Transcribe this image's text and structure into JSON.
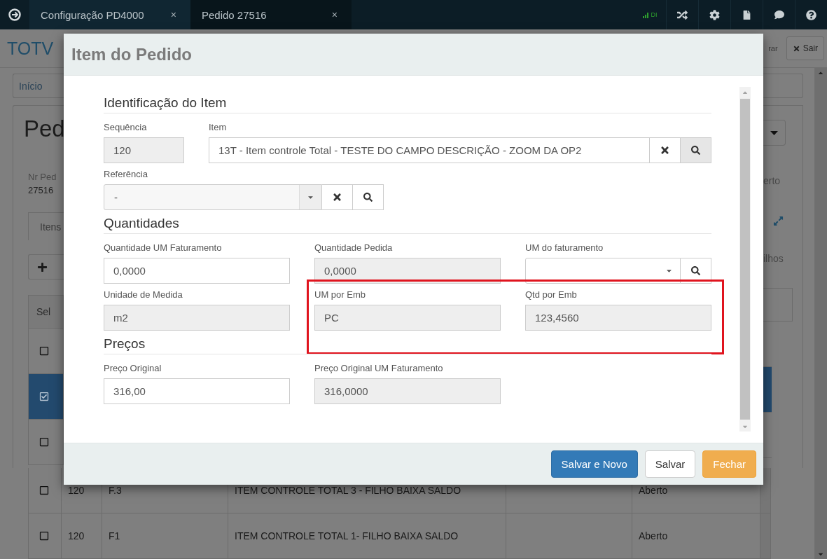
{
  "top_bar": {
    "tabs": [
      {
        "label": "Configuração PD4000",
        "close": "×",
        "selected": false
      },
      {
        "label": "Pedido 27516",
        "close": "×",
        "selected": true
      }
    ],
    "signal_label": "DI"
  },
  "background": {
    "brand": "TOTV",
    "header_fragment": "rar",
    "exit_button": "Sair",
    "breadcrumb": "Início",
    "title": "Ped",
    "order_label": "Nr Ped",
    "order_number": "27516",
    "tab": "Itens",
    "status_fragment": "erto",
    "children_fragment": "ilhos",
    "table": {
      "header": "Sel",
      "rows": [
        {
          "selected": false
        },
        {
          "selected": true
        },
        {
          "selected": false
        },
        {
          "selected": false,
          "cells": [
            "120",
            "F.3",
            "ITEM CONTROLE TOTAL 3 - FILHO BAIXA SALDO",
            "",
            "Aberto"
          ]
        },
        {
          "selected": false,
          "cells": [
            "120",
            "F1",
            "ITEM CONTROLE TOTAL 1- FILHO BAIXA SALDO",
            "",
            "Aberto"
          ]
        }
      ]
    }
  },
  "dialog": {
    "title": "Item do Pedido",
    "sections": [
      {
        "heading": "Identificação do Item",
        "rows": [
          {
            "fields": [
              {
                "kind": "text",
                "label": "Sequência",
                "value": "120",
                "disabled": true,
                "highlighted": false
              },
              {
                "kind": "lookup",
                "label": "Item",
                "value": "13T - Item controle Total - TESTE DO CAMPO DESCRIÇÃO - ZOOM DA OP2",
                "disabled": false,
                "highlighted": false
              }
            ]
          },
          {
            "fields": [
              {
                "kind": "select-lookup",
                "label": "Referência",
                "value": "-",
                "disabled": false,
                "highlighted": false
              }
            ]
          }
        ]
      },
      {
        "heading": "Quantidades",
        "rows": [
          {
            "fields": [
              {
                "kind": "text",
                "label": "Quantidade UM Faturamento",
                "value": "0,0000",
                "disabled": false,
                "highlighted": false
              },
              {
                "kind": "text",
                "label": "Quantidade Pedida",
                "value": "0,0000",
                "disabled": true,
                "highlighted": false
              },
              {
                "kind": "select-search",
                "label": "UM do faturamento",
                "disabled": false,
                "highlighted": false
              }
            ]
          },
          {
            "fields": [
              {
                "kind": "text",
                "label": "Unidade de Medida",
                "value": "m2",
                "disabled": true,
                "highlighted": false
              },
              {
                "kind": "text",
                "label": "UM por Emb",
                "value": "PC",
                "disabled": true,
                "highlighted": true
              },
              {
                "kind": "text",
                "label": "Qtd por Emb",
                "value": "123,4560",
                "disabled": true,
                "highlighted": true
              }
            ]
          }
        ]
      },
      {
        "heading": "Preços",
        "rows": [
          {
            "fields": [
              {
                "kind": "text",
                "label": "Preço Original",
                "value": "316,00",
                "disabled": false,
                "highlighted": false
              },
              {
                "kind": "text",
                "label": "Preço Original UM Faturamento",
                "value": "316,0000",
                "disabled": true,
                "highlighted": false
              }
            ]
          }
        ]
      }
    ],
    "buttons": [
      {
        "label": "Salvar e Novo",
        "kind": "primary"
      },
      {
        "label": "Salvar",
        "kind": "default"
      },
      {
        "label": "Fechar",
        "kind": "warning"
      }
    ]
  }
}
